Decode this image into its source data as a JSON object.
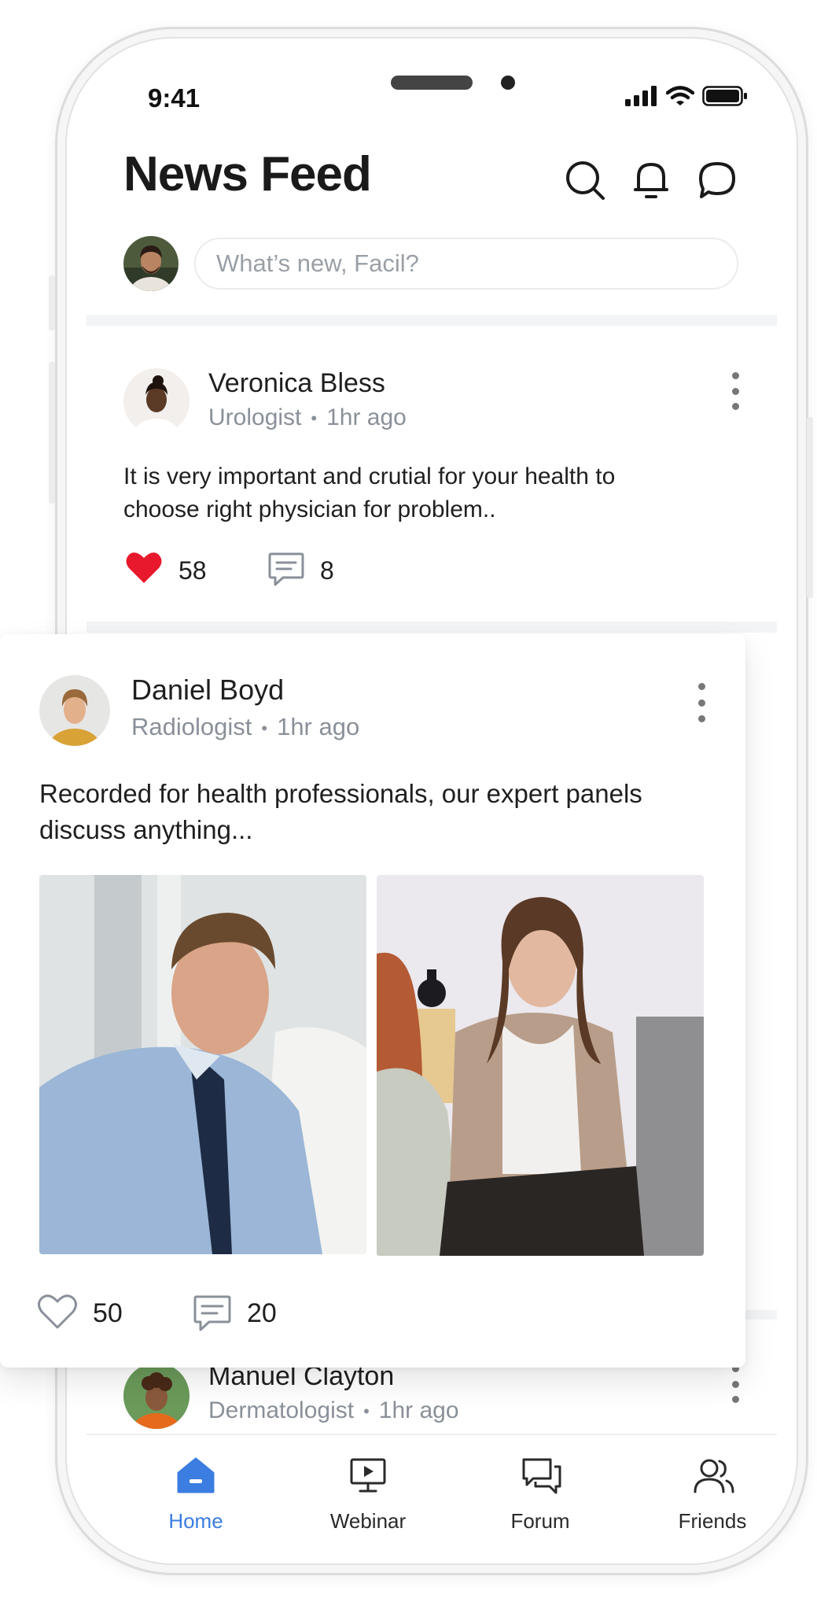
{
  "status_bar": {
    "time": "9:41"
  },
  "header": {
    "title": "News Feed"
  },
  "composer": {
    "placeholder": "What’s new, Facil?"
  },
  "posts": [
    {
      "author": "Veronica Bless",
      "role": "Urologist",
      "time": "1hr ago",
      "text": "It is very important and crutial for your health to choose right physician for problem..",
      "likes": "58",
      "comments": "8",
      "liked": true
    },
    {
      "author": "Daniel Boyd",
      "role": "Radiologist",
      "time": "1hr ago",
      "text": "Recorded for health professionals, our expert panels discuss anything...",
      "likes": "50",
      "comments": "20",
      "liked": false
    },
    {
      "author": "Manuel Clayton",
      "role": "Dermatologist",
      "time": "1hr ago"
    }
  ],
  "nav": {
    "items": [
      {
        "label": "Home",
        "icon": "home-icon",
        "active": true
      },
      {
        "label": "Webinar",
        "icon": "monitor-play-icon",
        "active": false
      },
      {
        "label": "Forum",
        "icon": "chat-bubbles-icon",
        "active": false
      },
      {
        "label": "Friends",
        "icon": "users-icon",
        "active": false
      }
    ]
  },
  "colors": {
    "accent": "#3b7de0",
    "like": "#e8192c",
    "muted": "#8a9099"
  }
}
